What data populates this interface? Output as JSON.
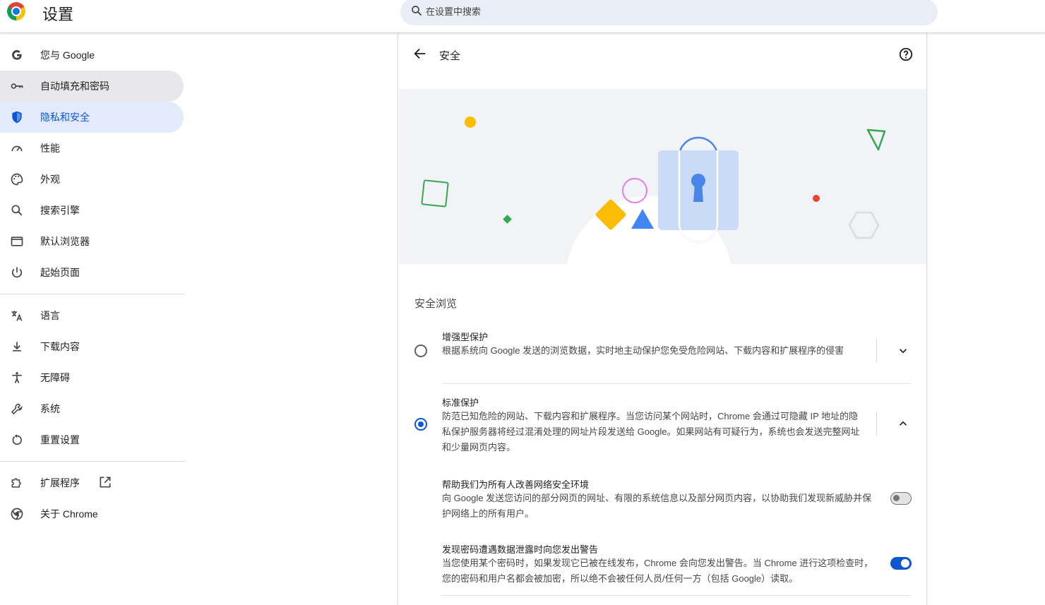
{
  "app": {
    "title": "设置"
  },
  "search": {
    "placeholder": "在设置中搜索"
  },
  "sidebar": {
    "items": [
      {
        "label": "您与 Google",
        "icon": "google-g-icon"
      },
      {
        "label": "自动填充和密码",
        "icon": "key-icon"
      },
      {
        "label": "隐私和安全",
        "icon": "shield-icon"
      },
      {
        "label": "性能",
        "icon": "speedometer-icon"
      },
      {
        "label": "外观",
        "icon": "palette-icon"
      },
      {
        "label": "搜索引擎",
        "icon": "search-icon"
      },
      {
        "label": "默认浏览器",
        "icon": "browser-window-icon"
      },
      {
        "label": "起始页面",
        "icon": "power-icon"
      },
      {
        "label": "语言",
        "icon": "translate-icon"
      },
      {
        "label": "下载内容",
        "icon": "download-icon"
      },
      {
        "label": "无障碍",
        "icon": "accessibility-icon"
      },
      {
        "label": "系统",
        "icon": "wrench-icon"
      },
      {
        "label": "重置设置",
        "icon": "reset-icon"
      },
      {
        "label": "扩展程序",
        "icon": "puzzle-icon"
      },
      {
        "label": "关于 Chrome",
        "icon": "chrome-icon"
      }
    ]
  },
  "page": {
    "title": "安全"
  },
  "safe_browsing": {
    "title": "安全浏览",
    "enhanced": {
      "title": "增强型保护",
      "desc": "根据系统向 Google 发送的浏览数据，实时地主动保护您免受危险网站、下载内容和扩展程序的侵害",
      "selected": false
    },
    "standard": {
      "title": "标准保护",
      "desc": "防范已知危险的网站、下载内容和扩展程序。当您访问某个网站时，Chrome 会通过可隐藏 IP 地址的隐私保护服务器将经过混淆处理的网址片段发送给 Google。如果网站有可疑行为，系统也会发送完整网址和少量网页内容。",
      "selected": true
    },
    "help_improve": {
      "title": "帮助我们为所有人改善网络安全环境",
      "desc": "向 Google 发送您访问的部分网页的网址、有限的系统信息以及部分网页内容，以协助我们发现新威胁并保护网络上的所有用户。",
      "enabled": false
    },
    "password_leak": {
      "title": "发现密码遭遇数据泄露时向您发出警告",
      "desc": "当您使用某个密码时，如果发现它已被在线发布，Chrome 会向您发出警告。当 Chrome 进行这项检查时，您的密码和用户名都会被加密，所以绝不会被任何人员/任何一方（包括 Google）读取。",
      "enabled": true
    }
  },
  "colors": {
    "accent": "#0b57d0",
    "active_nav_bg": "#e2eafb"
  }
}
